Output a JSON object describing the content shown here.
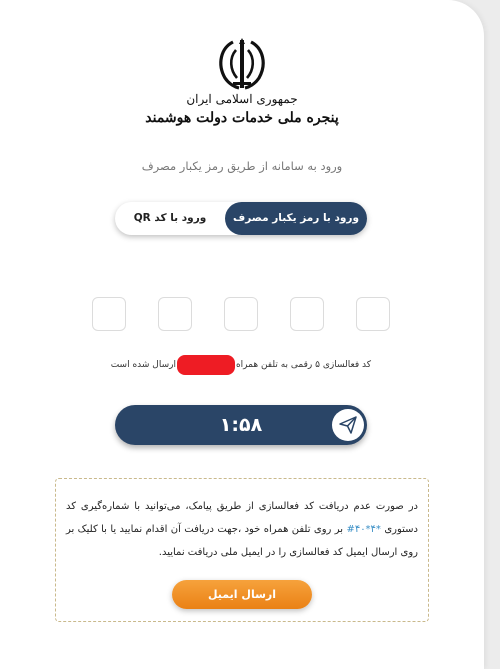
{
  "portal": {
    "line1": "جمهوری اسلامی ایران",
    "line2": "پنجره ملی خدمات دولت هوشمند"
  },
  "login": {
    "subtitle": "ورود به سامانه از طریق رمز یکبار مصرف",
    "tab_otp_label": "ورود با رمز یکبار مصرف",
    "tab_qr_label": "ورود با کد QR",
    "active_tab": "otp"
  },
  "otp": {
    "digits": [
      "",
      "",
      "",
      "",
      ""
    ]
  },
  "sent_message": {
    "prefix": "کد فعالسازی ۵ رقمی به تلفن همراه",
    "suffix": "ارسال شده است"
  },
  "timer": {
    "value": "۱:۵۸"
  },
  "notice": {
    "text_before_code": "در صورت عدم دریافت کد فعالسازی از طریق پیامک، می‌توانید با شماره‌گیری کد دستوری",
    "code": "#۴۰*۴*",
    "text_after_code": "بر روی تلفن همراه خود ،جهت دریافت آن اقدام نمایید یا با کلیک بر روی ارسال ایمیل کد فعالسازی را در ایمیل ملی دریافت نمایید.",
    "email_button_label": "ارسال ایمیل"
  },
  "colors": {
    "primary_navy": "#2a4567",
    "accent_orange": "#f39323",
    "code_blue": "#3a8fc6",
    "redaction_red": "#ee1c24"
  },
  "icons": {
    "emblem": "iran-emblem-icon",
    "send": "paper-plane-icon"
  }
}
